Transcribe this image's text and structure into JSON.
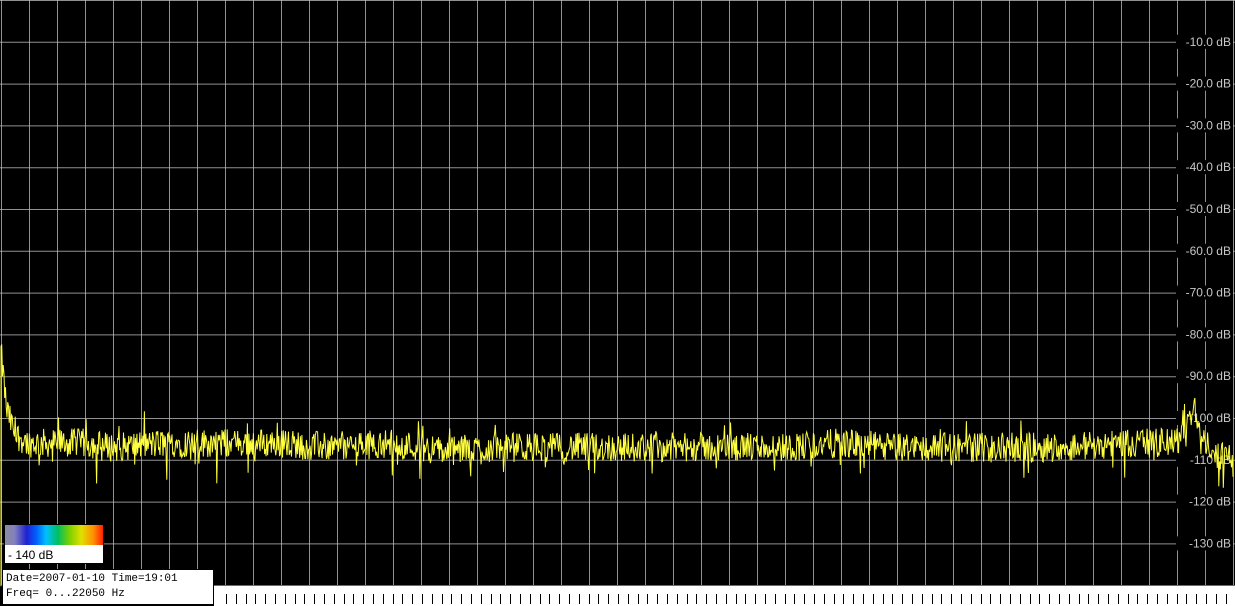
{
  "chart_data": {
    "type": "line",
    "title": "",
    "xlabel": "",
    "ylabel": "",
    "xlim": [
      0,
      22050
    ],
    "ylim": [
      -140,
      0
    ],
    "grid": true,
    "y_ticks": [
      {
        "value": -10,
        "label": "-10.0 dB"
      },
      {
        "value": -20,
        "label": "-20.0 dB"
      },
      {
        "value": -30,
        "label": "-30.0 dB"
      },
      {
        "value": -40,
        "label": "-40.0 dB"
      },
      {
        "value": -50,
        "label": "-50.0 dB"
      },
      {
        "value": -60,
        "label": "-60.0 dB"
      },
      {
        "value": -70,
        "label": "-70.0 dB"
      },
      {
        "value": -80,
        "label": "-80.0 dB"
      },
      {
        "value": -90,
        "label": "-90.0 dB"
      },
      {
        "value": -100,
        "label": "-100 dB"
      },
      {
        "value": -110,
        "label": "-110 dB"
      },
      {
        "value": -120,
        "label": "-120 dB"
      },
      {
        "value": -130,
        "label": "-130 dB"
      }
    ],
    "series": [
      {
        "color": "#ffff40",
        "x": [
          0,
          100,
          250,
          500,
          1000,
          1500,
          2000,
          3000,
          4000,
          5000,
          6000,
          7000,
          8000,
          9000,
          10000,
          11000,
          12000,
          13000,
          14000,
          15000,
          16000,
          17000,
          18000,
          19000,
          20000,
          21000,
          21200,
          21350,
          21500,
          21800,
          22050
        ],
        "y": [
          -84,
          -98,
          -104,
          -106,
          -106,
          -106,
          -107,
          -106,
          -106,
          -106,
          -107,
          -106,
          -108,
          -107,
          -107,
          -107,
          -107,
          -107,
          -107,
          -106,
          -107,
          -107,
          -107,
          -107,
          -106,
          -106,
          -104,
          -96,
          -106,
          -109,
          -109
        ]
      }
    ],
    "colors": {
      "background": "#000000",
      "grid": "#c0c0c0",
      "trace": "#ffff40"
    }
  },
  "colorbar": {
    "label": "- 140 dB"
  },
  "info": {
    "line1": "Date=2007-01-10 Time=19:01",
    "line2": "Freq= 0...22050 Hz"
  }
}
